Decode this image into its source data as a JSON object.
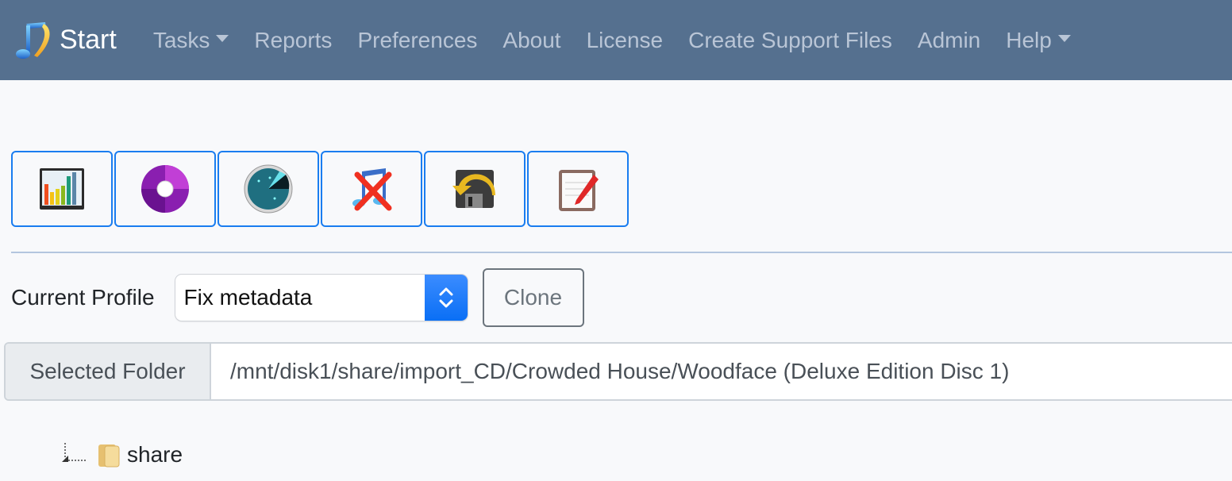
{
  "navbar": {
    "brand_label": "Start",
    "items": [
      {
        "label": "Tasks",
        "dropdown": true
      },
      {
        "label": "Reports",
        "dropdown": false
      },
      {
        "label": "Preferences",
        "dropdown": false
      },
      {
        "label": "About",
        "dropdown": false
      },
      {
        "label": "License",
        "dropdown": false
      },
      {
        "label": "Create Support Files",
        "dropdown": false
      },
      {
        "label": "Admin",
        "dropdown": false
      },
      {
        "label": "Help",
        "dropdown": true
      }
    ],
    "bg_color": "#55708f"
  },
  "toolbar": {
    "buttons": [
      {
        "icon": "bar-chart-icon"
      },
      {
        "icon": "cd-disc-icon"
      },
      {
        "icon": "radar-icon"
      },
      {
        "icon": "music-delete-icon"
      },
      {
        "icon": "save-undo-icon"
      },
      {
        "icon": "notepad-edit-icon"
      }
    ],
    "accent_color": "#1a7df0"
  },
  "profile": {
    "label": "Current Profile",
    "selected": "Fix metadata",
    "clone_label": "Clone"
  },
  "folder": {
    "label": "Selected Folder",
    "value": "/mnt/disk1/share/import_CD/Crowded House/Woodface (Deluxe Edition Disc 1)"
  },
  "tree": {
    "nodes": [
      {
        "label": "share"
      }
    ]
  }
}
